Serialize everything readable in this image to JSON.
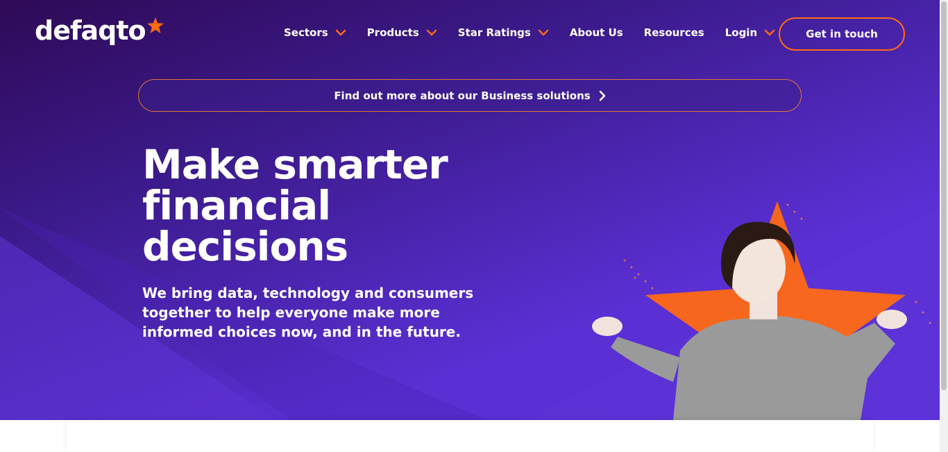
{
  "brand": {
    "logo_text": "defaqto",
    "accent_color": "#ff6a13",
    "primary_color": "#5a2fd3"
  },
  "nav": {
    "items": [
      {
        "label": "Sectors",
        "has_dropdown": true
      },
      {
        "label": "Products",
        "has_dropdown": true
      },
      {
        "label": "Star Ratings",
        "has_dropdown": true
      },
      {
        "label": "About Us",
        "has_dropdown": false
      },
      {
        "label": "Resources",
        "has_dropdown": false
      },
      {
        "label": "Login",
        "has_dropdown": true
      }
    ],
    "cta_label": "Get in touch"
  },
  "banner": {
    "label": "Find out more about our Business solutions",
    "icon": "chevron-right-icon"
  },
  "hero": {
    "headline_word1": "Make",
    "headline_highlight": "smarter",
    "headline_line2": "financial",
    "headline_line3": "decisions",
    "subtext": "We bring data, technology and consumers together to help everyone make more informed choices now, and in the future."
  }
}
